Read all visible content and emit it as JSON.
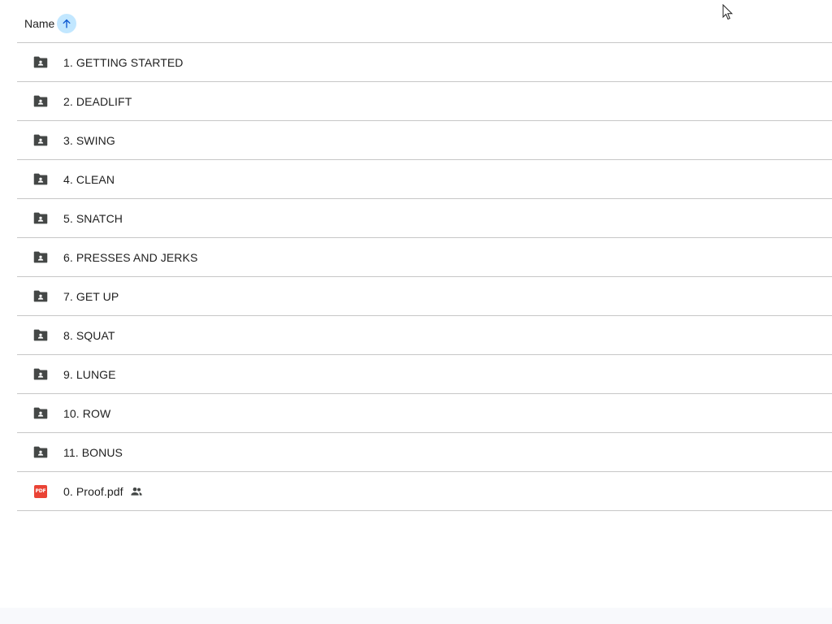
{
  "header": {
    "name_label": "Name",
    "sort_icon": "arrow-up-icon"
  },
  "items": [
    {
      "label": "1. GETTING STARTED",
      "icon": "shared-folder-icon"
    },
    {
      "label": "2. DEADLIFT",
      "icon": "shared-folder-icon"
    },
    {
      "label": "3. SWING",
      "icon": "shared-folder-icon"
    },
    {
      "label": "4. CLEAN",
      "icon": "shared-folder-icon"
    },
    {
      "label": "5. SNATCH",
      "icon": "shared-folder-icon"
    },
    {
      "label": "6. PRESSES AND JERKS",
      "icon": "shared-folder-icon"
    },
    {
      "label": "7. GET UP",
      "icon": "shared-folder-icon"
    },
    {
      "label": "8. SQUAT",
      "icon": "shared-folder-icon"
    },
    {
      "label": "9. LUNGE",
      "icon": "shared-folder-icon"
    },
    {
      "label": "10. ROW",
      "icon": "shared-folder-icon"
    },
    {
      "label": "11. BONUS",
      "icon": "shared-folder-icon"
    }
  ],
  "file": {
    "label": "0. Proof.pdf",
    "icon": "pdf-icon",
    "badge": "PDF",
    "shared_icon": "people-icon"
  },
  "colors": {
    "folder": "#444746",
    "pdf": "#ea4335",
    "sort_bg": "#c2e7ff",
    "divider": "#c7c7c7"
  }
}
